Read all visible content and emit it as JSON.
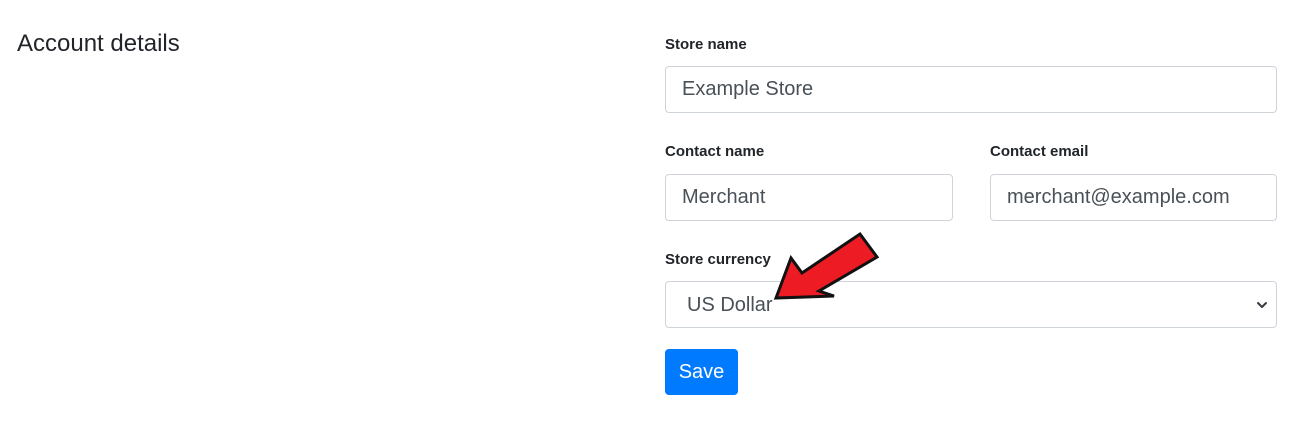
{
  "section": {
    "title": "Account details"
  },
  "form": {
    "store_name": {
      "label": "Store name",
      "value": "Example Store"
    },
    "contact_name": {
      "label": "Contact name",
      "value": "Merchant"
    },
    "contact_email": {
      "label": "Contact email",
      "value": "merchant@example.com"
    },
    "store_currency": {
      "label": "Store currency",
      "selected": "US Dollar"
    },
    "save_label": "Save"
  },
  "annotation": {
    "arrow_color": "#ed1c24",
    "arrow_icon": "red-pointer-arrow"
  },
  "colors": {
    "primary": "#007bff",
    "input_border": "#ced4da",
    "text": "#212529",
    "input_text": "#495057"
  }
}
